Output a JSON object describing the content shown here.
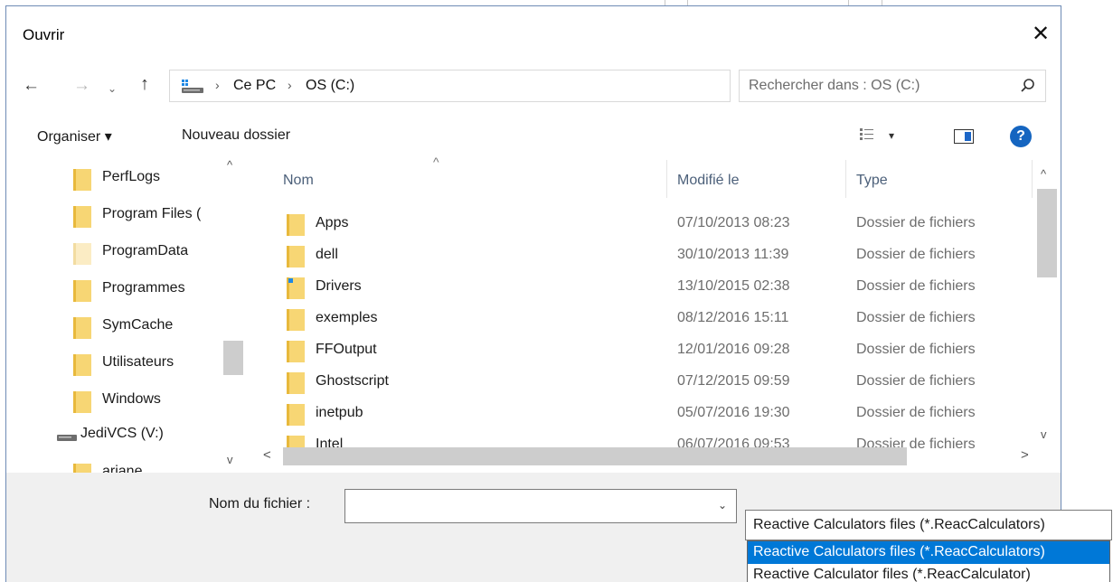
{
  "dialog": {
    "title": "Ouvrir"
  },
  "nav": {
    "back": "←",
    "forward": "→",
    "recent": "⌄",
    "up": "↑",
    "breadcrumb": [
      "Ce PC",
      "OS (C:)"
    ],
    "separator": "›",
    "dropdown": "⌄",
    "refresh": "↻",
    "search_placeholder": "Rechercher dans : OS (C:)"
  },
  "toolbar": {
    "organize_label": "Organiser ▾",
    "new_folder_label": "Nouveau dossier",
    "view_arrow": "▾",
    "help_label": "?"
  },
  "navtree": {
    "items": [
      {
        "label": "PerfLogs",
        "kind": "folder"
      },
      {
        "label": "Program Files (",
        "kind": "folder"
      },
      {
        "label": "ProgramData",
        "kind": "folder-hidden"
      },
      {
        "label": "Programmes",
        "kind": "folder"
      },
      {
        "label": "SymCache",
        "kind": "folder"
      },
      {
        "label": "Utilisateurs",
        "kind": "folder"
      },
      {
        "label": "Windows",
        "kind": "folder"
      },
      {
        "label": "JediVCS (V:)",
        "kind": "drive"
      },
      {
        "label": "ariane",
        "kind": "folder"
      }
    ],
    "scroll_up": "^",
    "scroll_down": "v"
  },
  "filelist": {
    "columns": {
      "name": "Nom",
      "modified": "Modifié le",
      "type": "Type"
    },
    "sort_indicator": "^",
    "rows": [
      {
        "name": "Apps",
        "modified": "07/10/2013 08:23",
        "type": "Dossier de fichiers",
        "icon": "folder-icon"
      },
      {
        "name": "dell",
        "modified": "30/10/2013 11:39",
        "type": "Dossier de fichiers",
        "icon": "folder-icon"
      },
      {
        "name": "Drivers",
        "modified": "13/10/2015 02:38",
        "type": "Dossier de fichiers",
        "icon": "folder-special-icon"
      },
      {
        "name": "exemples",
        "modified": "08/12/2016 15:11",
        "type": "Dossier de fichiers",
        "icon": "folder-icon"
      },
      {
        "name": "FFOutput",
        "modified": "12/01/2016 09:28",
        "type": "Dossier de fichiers",
        "icon": "folder-icon"
      },
      {
        "name": "Ghostscript",
        "modified": "07/12/2015 09:59",
        "type": "Dossier de fichiers",
        "icon": "folder-icon"
      },
      {
        "name": "inetpub",
        "modified": "05/07/2016 19:30",
        "type": "Dossier de fichiers",
        "icon": "folder-icon"
      },
      {
        "name": "Intel",
        "modified": "06/07/2016 09:53",
        "type": "Dossier de fichiers",
        "icon": "folder-icon"
      }
    ],
    "scroll_up": "^",
    "scroll_down": "v",
    "scroll_left": "<",
    "scroll_right": ">"
  },
  "bottom": {
    "filename_label": "Nom du fichier :",
    "filename_value": "",
    "filename_arrow": "⌄",
    "filter_selected": "Reactive Calculators files (*.ReacCalculators)",
    "filter_options": [
      "Reactive Calculators files (*.ReacCalculators)",
      "Reactive Calculator files (*.ReacCalculator)"
    ]
  },
  "colors": {
    "folder": "#f7d674",
    "folder_dark": "#e8b93c",
    "selection": "#0078d7",
    "help": "#1565c0",
    "header_text": "#4c607a"
  }
}
